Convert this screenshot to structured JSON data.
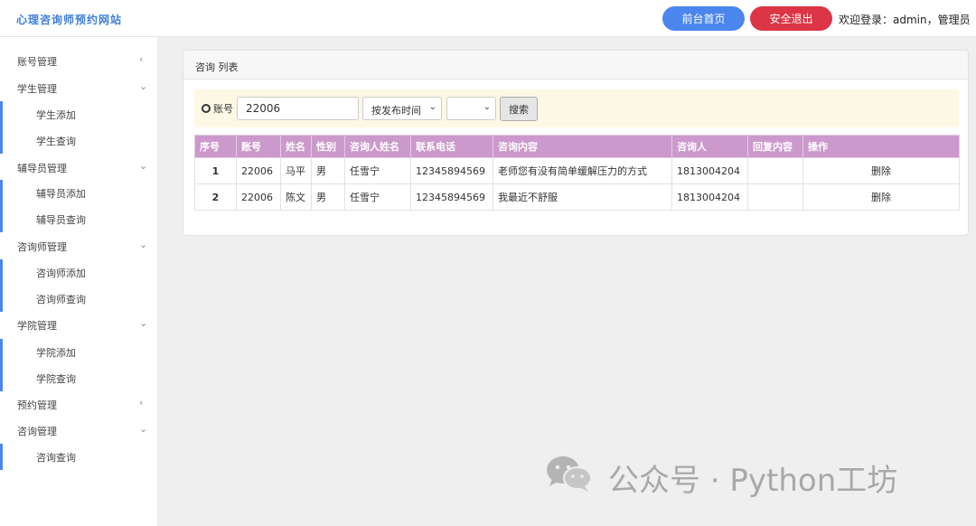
{
  "header": {
    "site_title": "心理咨询师预约网站",
    "home_button": "前台首页",
    "logout_button": "安全退出",
    "welcome": "欢迎登录：admin，管理员"
  },
  "sidebar": {
    "groups": [
      {
        "label": "账号管理",
        "arrow": "‹"
      },
      {
        "label": "学生管理",
        "arrow": "⌄",
        "items": [
          "学生添加",
          "学生查询"
        ]
      },
      {
        "label": "辅导员管理",
        "arrow": "⌄",
        "items": [
          "辅导员添加",
          "辅导员查询"
        ]
      },
      {
        "label": "咨询师管理",
        "arrow": "⌄",
        "items": [
          "咨询师添加",
          "咨询师查询"
        ]
      },
      {
        "label": "学院管理",
        "arrow": "⌄",
        "items": [
          "学院添加",
          "学院查询"
        ]
      },
      {
        "label": "预约管理",
        "arrow": "‹"
      },
      {
        "label": "咨询管理",
        "arrow": "⌄",
        "items": [
          "咨询查询"
        ]
      }
    ]
  },
  "panel": {
    "title": "咨询 列表",
    "search": {
      "label": "账号",
      "value": "22006",
      "order_select": "按发布时间",
      "blank_select": "",
      "button": "搜索"
    },
    "table": {
      "headers": [
        "序号",
        "账号",
        "姓名",
        "性别",
        "咨询人姓名",
        "联系电话",
        "咨询内容",
        "咨询人",
        "回复内容",
        "操作"
      ],
      "rows": [
        [
          "1",
          "22006",
          "马平",
          "男",
          "任雪宁",
          "12345894569",
          "老师您有没有简单缓解压力的方式",
          "1813004204",
          "",
          "删除"
        ],
        [
          "2",
          "22006",
          "陈文",
          "男",
          "任雪宁",
          "12345894569",
          "我最近不舒服",
          "1813004204",
          "",
          "删除"
        ]
      ]
    }
  },
  "watermark": {
    "text": "公众号 · Python工坊",
    "logo_icon": "wechat-icon"
  },
  "colors": {
    "accent_blue": "#4a86ec",
    "danger_red": "#dc3545",
    "table_header": "#cc99cc",
    "search_bg": "#fcf8e3"
  }
}
